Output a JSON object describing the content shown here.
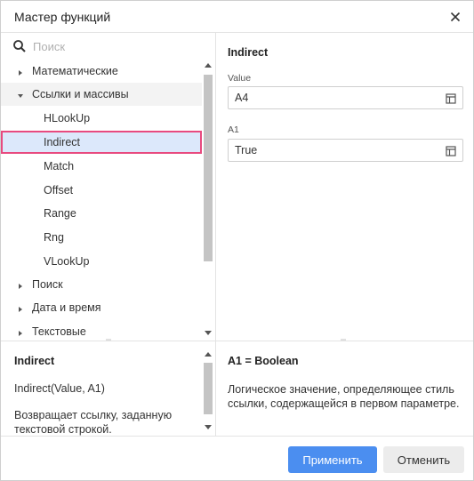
{
  "dialog": {
    "title": "Мастер функций",
    "close_icon": "close-icon"
  },
  "search": {
    "placeholder": "Поиск",
    "value": ""
  },
  "tree": {
    "items": [
      {
        "label": "Математические",
        "type": "category",
        "expanded": false
      },
      {
        "label": "Ссылки и массивы",
        "type": "category",
        "expanded": true
      },
      {
        "label": "HLookUp",
        "type": "function"
      },
      {
        "label": "Indirect",
        "type": "function",
        "selected": true
      },
      {
        "label": "Match",
        "type": "function"
      },
      {
        "label": "Offset",
        "type": "function"
      },
      {
        "label": "Range",
        "type": "function"
      },
      {
        "label": "Rng",
        "type": "function"
      },
      {
        "label": "VLookUp",
        "type": "function"
      },
      {
        "label": "Поиск",
        "type": "category",
        "expanded": false
      },
      {
        "label": "Дата и время",
        "type": "category",
        "expanded": false
      },
      {
        "label": "Текстовые",
        "type": "category",
        "expanded": false
      }
    ]
  },
  "params": {
    "function_name": "Indirect",
    "fields": [
      {
        "label": "Value",
        "value": "A4"
      },
      {
        "label": "A1",
        "value": "True"
      }
    ]
  },
  "info": {
    "function_name": "Indirect",
    "syntax": "Indirect(Value, A1)",
    "description": "Возвращает ссылку, заданную текстовой строкой."
  },
  "param_info": {
    "title": "A1 = Boolean",
    "description": "Логическое значение, определяющее стиль ссылки, содержащейся в первом параметре."
  },
  "footer": {
    "apply_label": "Применить",
    "cancel_label": "Отменить"
  },
  "colors": {
    "accent": "#4b8ef0",
    "selection_bg": "#dce8fb",
    "selection_border": "#e84a7f"
  }
}
